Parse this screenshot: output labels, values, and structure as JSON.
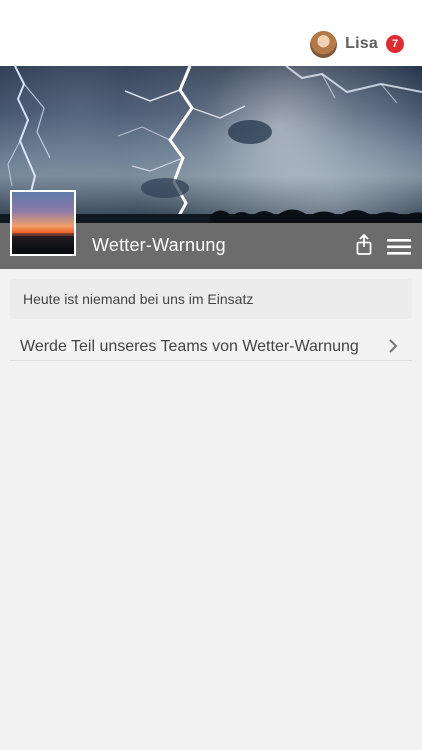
{
  "header": {
    "user_name": "Lisa",
    "notification_count": "7"
  },
  "page": {
    "title": "Wetter-Warnung",
    "notice": "Heute ist niemand bei uns im Einsatz",
    "join_label": "Werde Teil unseres Teams von Wetter-Warnung"
  },
  "icons": {
    "avatar": "avatar-icon",
    "share": "share-icon",
    "menu": "menu-icon",
    "chevron": "chevron-right-icon"
  },
  "colors": {
    "badge": "#e02b2f",
    "titlebar": "#6c6c6c",
    "background": "#f2f2f2",
    "text": "#444444"
  }
}
